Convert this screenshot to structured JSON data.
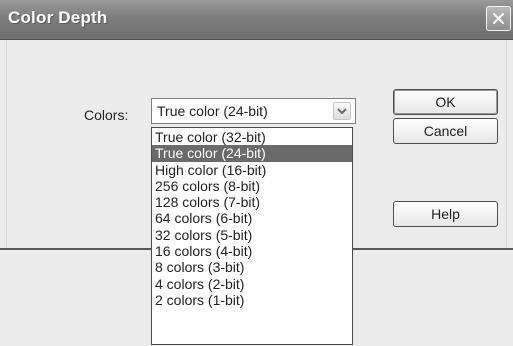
{
  "window": {
    "title": "Color Depth"
  },
  "form": {
    "colors_label": "Colors:",
    "colors_selected": "True color (24-bit)",
    "colors_options": [
      "True color (32-bit)",
      "True color (24-bit)",
      "High color (16-bit)",
      "256 colors (8-bit)",
      "128 colors (7-bit)",
      "64 colors (6-bit)",
      "32 colors (5-bit)",
      "16 colors (4-bit)",
      "8 colors (3-bit)",
      "4 colors (2-bit)",
      "2 colors (1-bit)"
    ],
    "highlighted_option": "True color (24-bit)"
  },
  "buttons": {
    "ok_label": "OK",
    "cancel_label": "Cancel",
    "help_label": "Help"
  },
  "icons": {
    "close": "close-icon",
    "dropdown": "chevron-down-icon"
  },
  "colors": {
    "titlebar": "#7d7d7d",
    "selection": "#6a6a6a",
    "dialog_bg": "#ececec"
  }
}
